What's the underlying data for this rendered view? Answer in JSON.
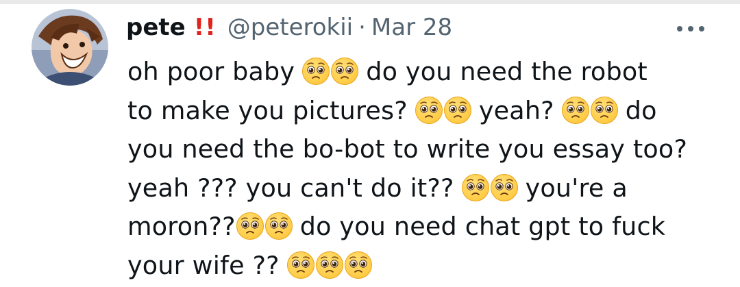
{
  "tweet": {
    "display_name": "pete",
    "name_decoration": "!!",
    "handle": "@peterokii",
    "separator": "·",
    "date": "Mar 28",
    "more_icon": "more-horizontal-icon",
    "avatar_icon": "avatar-anime-character",
    "emoji_name": "pleading-face-emoji",
    "text_lines": [
      [
        "oh poor baby ",
        "",
        "",
        " do you need the robot"
      ],
      [
        "to make you pictures? ",
        "",
        "",
        " yeah? ",
        "",
        "",
        " do"
      ],
      [
        "you need the bo-bot to write you essay too?"
      ],
      [
        "yeah ??? you can't do it?? ",
        "",
        "",
        " you're a"
      ],
      [
        "moron??",
        "",
        "",
        " do you need chat gpt to fuck"
      ],
      [
        "your wife ?? ",
        "",
        "",
        ""
      ]
    ],
    "text_segments": {
      "l1a": "oh poor baby",
      "l1b": "do you need the robot",
      "l2a": "to make you pictures?",
      "l2b": "yeah?",
      "l2c": "do",
      "l3": "you need the bo-bot to write you essay too?",
      "l4a": "yeah ??? you can't do it??",
      "l4b": "you're a",
      "l5a": "moron??",
      "l5b": "do you need chat gpt to fuck",
      "l6a": "your wife ??"
    },
    "colors": {
      "text": "#0f1419",
      "secondary": "#536471",
      "bangs": "#e0241d",
      "emoji_face": "#ffc83d"
    }
  }
}
